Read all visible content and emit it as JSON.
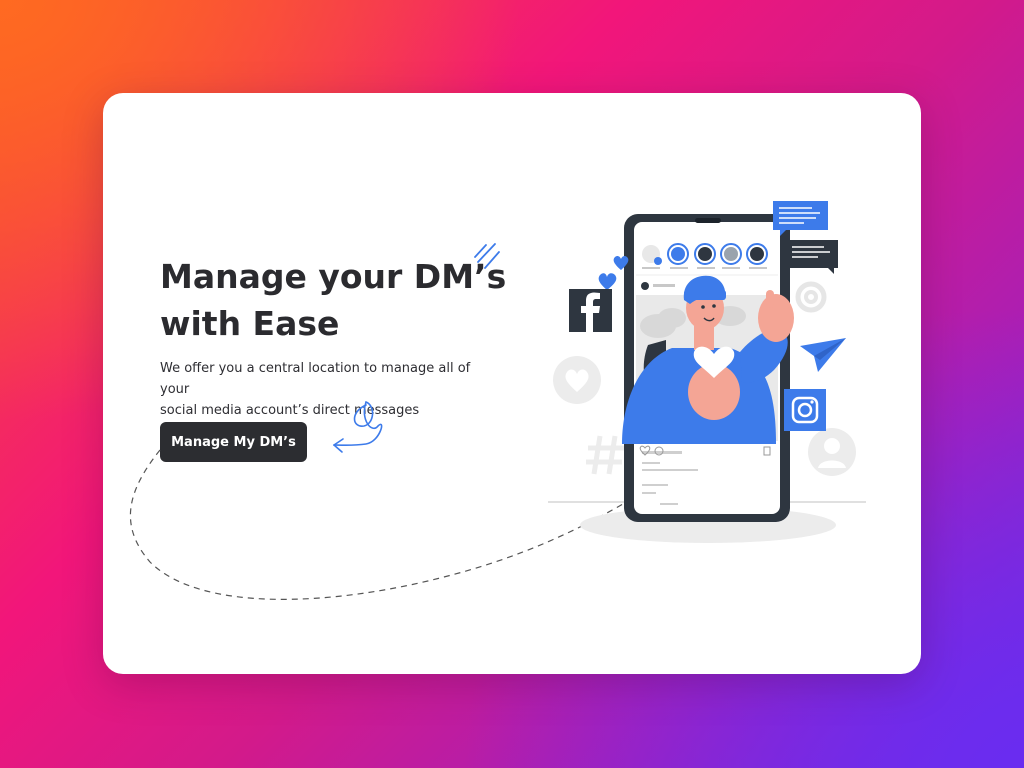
{
  "hero": {
    "headline_line1": "Manage your DM’s",
    "headline_line2": "with Ease",
    "subtitle_line1": "We offer you a central location to manage all of your",
    "subtitle_line2": "social media account’s direct messages",
    "cta_label": "Manage My DM’s"
  },
  "colors": {
    "card_background": "#ffffff",
    "text_dark": "#2b2b2f",
    "button_background": "#2c2d31",
    "accent_blue": "#3d7bea",
    "illustration_gray": "#f0f0f0",
    "phone_frame": "#2e3640"
  },
  "illustration": {
    "icons": [
      "facebook-icon",
      "instagram-icon",
      "heart-icon",
      "at-sign-icon",
      "hashtag-icon",
      "paper-plane-icon",
      "chat-bubble-icon",
      "user-avatar-icon"
    ]
  }
}
